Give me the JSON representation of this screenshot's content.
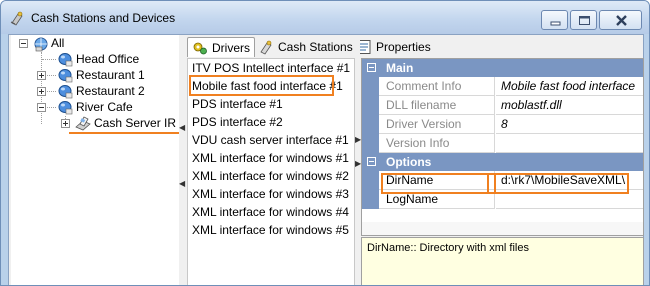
{
  "window": {
    "title": "Cash Stations and Devices"
  },
  "tree": {
    "items": [
      {
        "label": "All"
      },
      {
        "label": "Head Office"
      },
      {
        "label": "Restaurant 1"
      },
      {
        "label": "Restaurant 2"
      },
      {
        "label": "River Cafe"
      },
      {
        "label": "Cash Server IR"
      }
    ]
  },
  "tabs": [
    {
      "label": "Drivers",
      "icon": "drivers-icon",
      "active": true
    },
    {
      "label": "Cash Stations",
      "icon": "cash-stations-icon",
      "active": false
    },
    {
      "label": "Properties",
      "icon": "properties-icon",
      "active": false
    }
  ],
  "drivers": [
    "ITV POS Intellect interface #1",
    "Mobile fast food interface #1",
    "PDS interface #1",
    "PDS interface #2",
    "VDU cash server interface #1",
    "XML interface for windows #1",
    "XML interface for windows #2",
    "XML interface for windows #3",
    "XML interface for windows #4",
    "XML interface for windows #5"
  ],
  "properties": {
    "main": {
      "category": "Main",
      "rows": [
        {
          "name": "Comment Info",
          "value": "Mobile fast food interface"
        },
        {
          "name": "DLL filename",
          "value": "moblastf.dll"
        },
        {
          "name": "Driver Version",
          "value": "8"
        },
        {
          "name": "Version Info",
          "value": ""
        }
      ]
    },
    "options": {
      "category": "Options",
      "rows": [
        {
          "name": "DirName",
          "value": "d:\\rk7\\MobileSaveXML\\"
        },
        {
          "name": "LogName",
          "value": ""
        }
      ]
    }
  },
  "description": "DirName:: Directory with xml files",
  "colors": {
    "highlight": "#f08020",
    "category_bg": "#7a96c2"
  }
}
